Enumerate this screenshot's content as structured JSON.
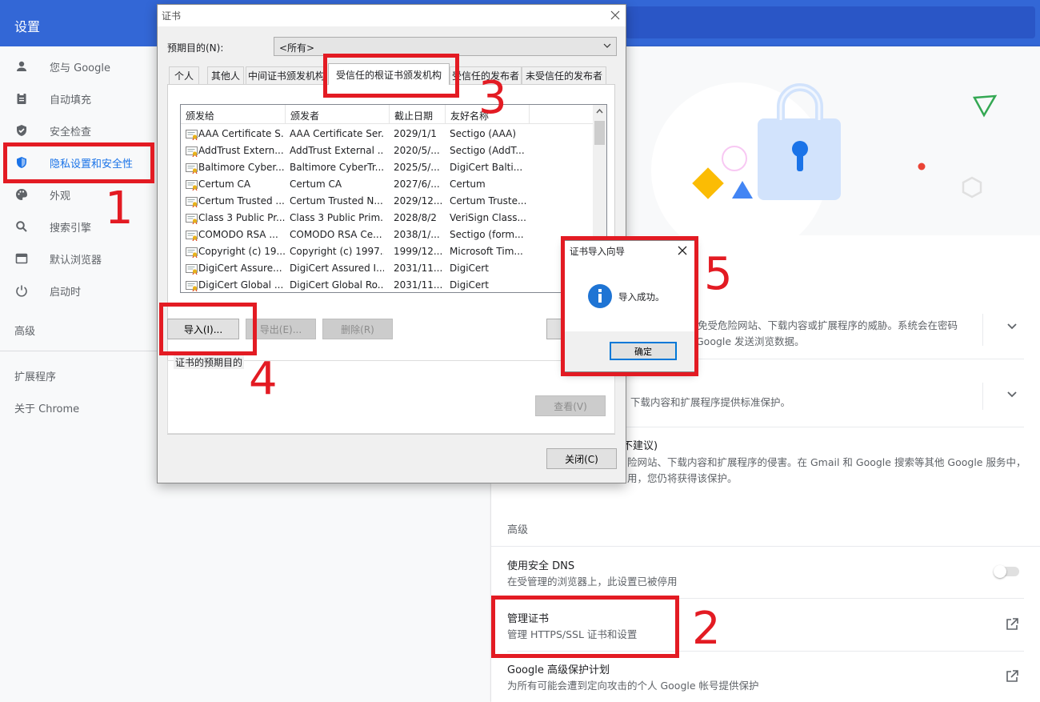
{
  "chrome": {
    "title": "设置",
    "nav": [
      {
        "label": "您与 Google",
        "icon": "person-icon"
      },
      {
        "label": "自动填充",
        "icon": "clipboard-icon"
      },
      {
        "label": "安全检查",
        "icon": "shield-check-icon"
      },
      {
        "label": "隐私设置和安全性",
        "icon": "shield-icon"
      },
      {
        "label": "外观",
        "icon": "palette-icon"
      },
      {
        "label": "搜索引擎",
        "icon": "search-icon"
      },
      {
        "label": "默认浏览器",
        "icon": "browser-icon"
      },
      {
        "label": "启动时",
        "icon": "power-icon"
      }
    ],
    "nav_advanced": "高级",
    "nav_extensions": "扩展程序",
    "nav_about": "关于 Chrome"
  },
  "panel": {
    "enhanced_desc_1": "免受危险网站、下载内容或扩展程序的威胁。系统会在密码",
    "enhanced_desc_2": "Google 发送浏览数据。",
    "standard_desc": "下载内容和扩展程序提供标准保护。",
    "noprotect_title": "不建议)",
    "noprotect_desc_1": "险网站、下载内容和扩展程序的侵害。在 Gmail 和 Google 搜索等其他 Google 服务中，",
    "noprotect_desc_2": "用，您仍将获得该保护。",
    "advanced_label": "高级",
    "dns_title": "使用安全 DNS",
    "dns_desc": "在受管理的浏览器上，此设置已被停用",
    "cert_title": "管理证书",
    "cert_desc": "管理 HTTPS/SSL 证书和设置",
    "gapp_title": "Google 高级保护计划",
    "gapp_desc": "为所有可能会遭到定向攻击的个人 Google 帐号提供保护"
  },
  "dialog": {
    "title": "证书",
    "purpose_label": "预期目的(N):",
    "purpose_value": "<所有>",
    "tabs": [
      "个人",
      "其他人",
      "中间证书颁发机构",
      "受信任的根证书颁发机构",
      "受信任的发布者",
      "未受信任的发布者"
    ],
    "columns": [
      "颁发给",
      "颁发者",
      "截止日期",
      "友好名称"
    ],
    "rows": [
      [
        "AAA Certificate S...",
        "AAA Certificate Ser...",
        "2029/1/1",
        "Sectigo (AAA)"
      ],
      [
        "AddTrust Extern...",
        "AddTrust External ...",
        "2020/5/...",
        "Sectigo (AddT..."
      ],
      [
        "Baltimore Cyber...",
        "Baltimore CyberTr...",
        "2025/5/...",
        "DigiCert Balti..."
      ],
      [
        "Certum CA",
        "Certum CA",
        "2027/6/...",
        "Certum"
      ],
      [
        "Certum Trusted ...",
        "Certum Trusted N...",
        "2029/12...",
        "Certum Truste..."
      ],
      [
        "Class 3 Public Pr...",
        "Class 3 Public Prim...",
        "2028/8/2",
        "VeriSign Class..."
      ],
      [
        "COMODO RSA ...",
        "COMODO RSA Ce...",
        "2038/1/...",
        "Sectigo (form..."
      ],
      [
        "Copyright (c) 19...",
        "Copyright (c) 1997...",
        "1999/12...",
        "Microsoft Tim..."
      ],
      [
        "DigiCert Assure...",
        "DigiCert Assured I...",
        "2031/11...",
        "DigiCert"
      ],
      [
        "DigiCert Global ...",
        "DigiCert Global Ro...",
        "2031/11...",
        "DigiCert"
      ]
    ],
    "import_btn": "导入(I)...",
    "export_btn": "导出(E)...",
    "remove_btn": "删除(R)",
    "purposes_group": "证书的预期目的",
    "view_btn": "查看(V)",
    "close_btn": "关闭(C)"
  },
  "wizard": {
    "title": "证书导入向导",
    "message": "导入成功。",
    "ok_btn": "确定"
  },
  "annotations": [
    "1",
    "2",
    "3",
    "4",
    "5"
  ],
  "colors": {
    "accent": "#1a73e8",
    "header": "#3367d6",
    "annotation": "#e31b23"
  }
}
